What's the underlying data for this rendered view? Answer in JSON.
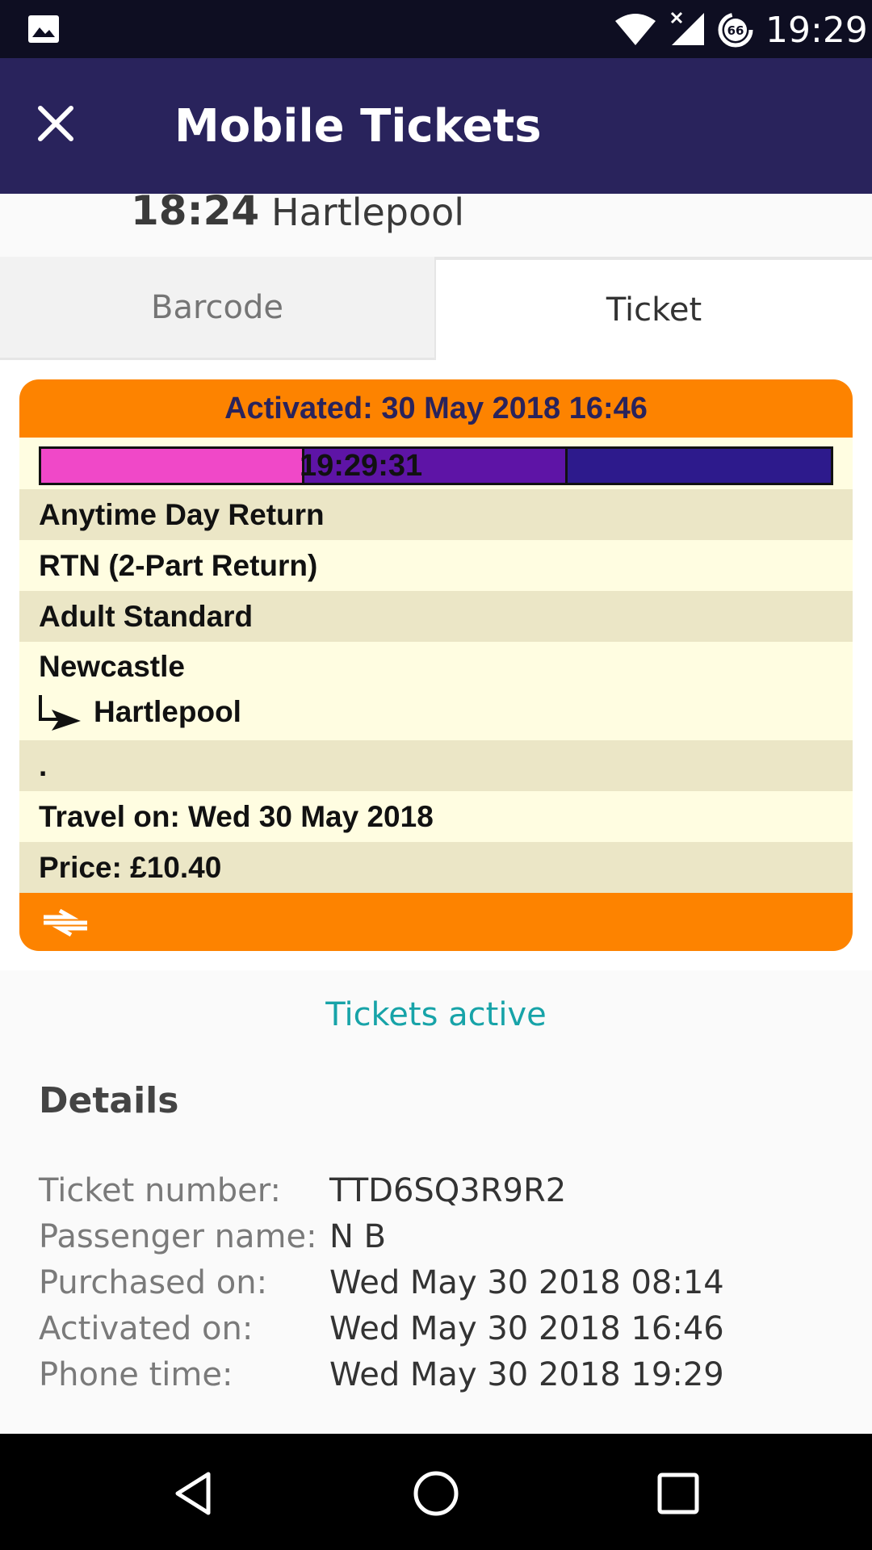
{
  "status_bar": {
    "time": "19:29",
    "battery_level": "66",
    "icons": [
      "gallery-icon",
      "wifi-icon",
      "signal-no-data-icon",
      "battery-saver-icon"
    ]
  },
  "app_bar": {
    "title": "Mobile Tickets",
    "close_icon": "close-icon"
  },
  "journey": {
    "time": "18:24",
    "destination": "Hartlepool"
  },
  "tabs": [
    {
      "label": "Barcode",
      "selected": false
    },
    {
      "label": "Ticket",
      "selected": true
    }
  ],
  "ticket": {
    "activated": "Activated: 30 May 2018 16:46",
    "timer": "19:29:31",
    "timer_colors": [
      "#f048c8",
      "#5e14a6",
      "#2d1a8c"
    ],
    "ticket_type": "Anytime Day Return",
    "ticket_code": "RTN (2-Part Return)",
    "passenger_class": "Adult Standard",
    "route_from": "Newcastle",
    "route_to": "Hartlepool",
    "route_note": ".",
    "travel_on": "Travel on:  Wed 30 May 2018",
    "price": "Price: £10.40",
    "accent_color": "#fd8300",
    "footer_icon": "national-rail-icon"
  },
  "status_text": "Tickets active",
  "details": {
    "title": "Details",
    "rows": [
      {
        "label": "Ticket number:",
        "value": "TTD6SQ3R9R2"
      },
      {
        "label": "Passenger name:",
        "value": "N B"
      },
      {
        "label": "Purchased on:",
        "value": "Wed May 30 2018 08:14"
      },
      {
        "label": "Activated on:",
        "value": "Wed May 30 2018 16:46"
      },
      {
        "label": "Phone time:",
        "value": "Wed May 30 2018 19:29"
      }
    ]
  },
  "nav_bar": {
    "icons": [
      "back-icon",
      "home-icon",
      "recents-icon"
    ]
  },
  "colors": {
    "app_bar": "#29235c",
    "status_bar": "#0e0e22",
    "active_text": "#17a3a8"
  }
}
